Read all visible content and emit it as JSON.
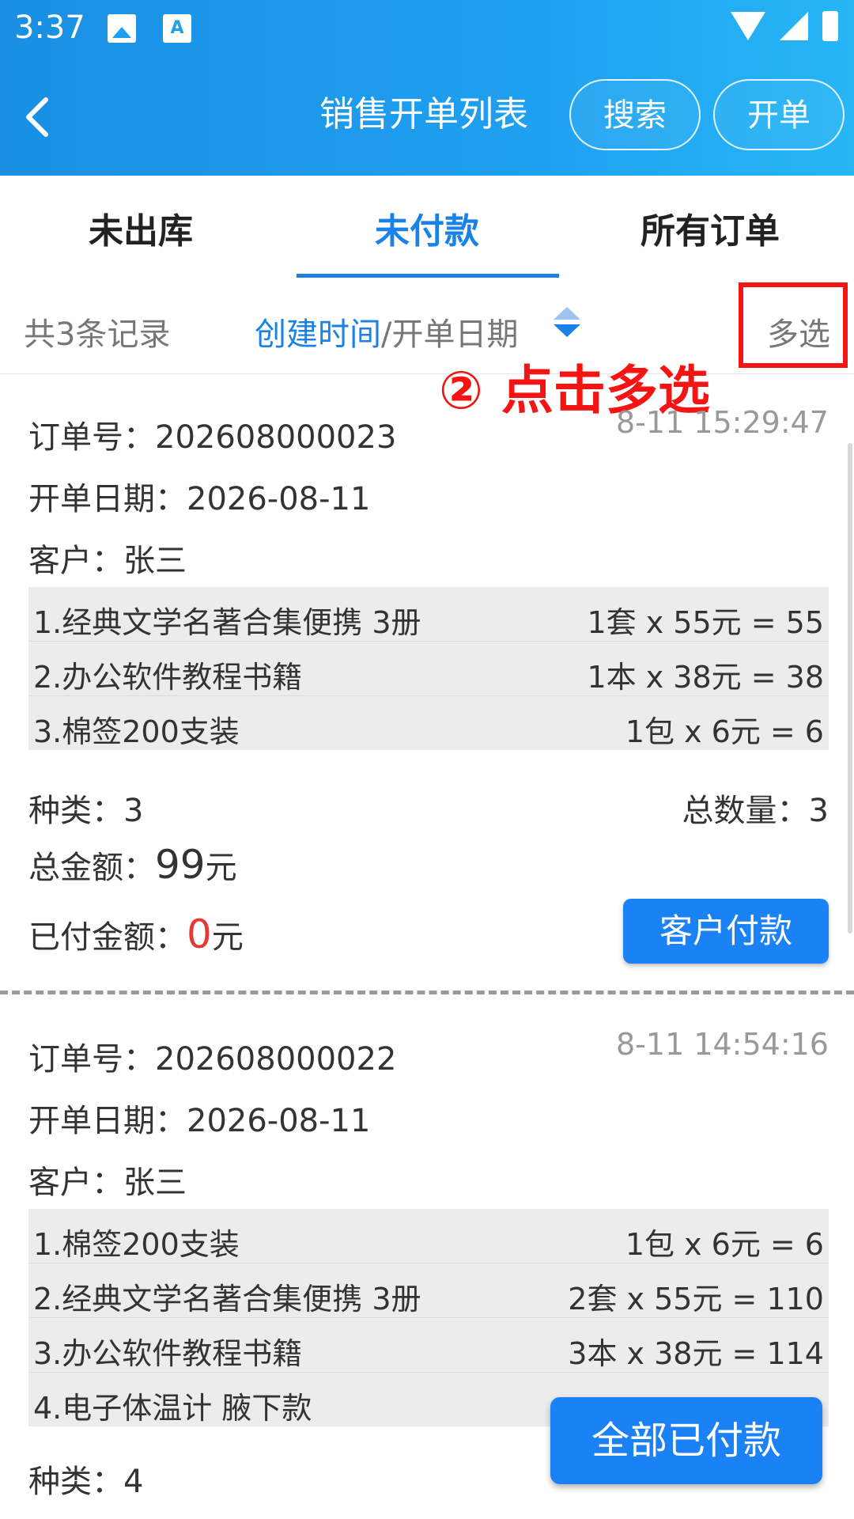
{
  "status": {
    "time": "3:37",
    "a_icon_text": "A"
  },
  "header": {
    "title": "销售开单列表",
    "search_label": "搜索",
    "create_label": "开单"
  },
  "tabs": [
    {
      "label": "未出库",
      "active": false
    },
    {
      "label": "未付款",
      "active": true
    },
    {
      "label": "所有订单",
      "active": false
    }
  ],
  "filter": {
    "count_text": "共3条记录",
    "sort_active": "创建时间",
    "sort_sep_other": "/开单日期",
    "multi_label": "多选"
  },
  "annotation": {
    "text": "② 点击多选",
    "color": "#f41414"
  },
  "orders": [
    {
      "order_no": "订单号：202608000023",
      "time": "8-11 15:29:47",
      "date": "开单日期：2026-08-11",
      "customer": "客户：张三",
      "items": [
        {
          "name": "1.经典文学名著合集便携 3册",
          "calc": "1套 x 55元 = 55"
        },
        {
          "name": "2.办公软件教程书籍",
          "calc": "1本 x 38元 = 38"
        },
        {
          "name": "3.棉签200支装",
          "calc": "1包 x 6元 = 6"
        }
      ],
      "kinds": "种类：3",
      "total_qty": "总数量：3",
      "total_label": "总金额：",
      "total_value": "99",
      "total_unit": "元",
      "paid_label": "已付金额：",
      "paid_value": "0",
      "paid_unit": "元",
      "pay_button": "客户付款"
    },
    {
      "order_no": "订单号：202608000022",
      "time": "8-11 14:54:16",
      "date": "开单日期：2026-08-11",
      "customer": "客户：张三",
      "items": [
        {
          "name": "1.棉签200支装",
          "calc": "1包 x 6元 = 6"
        },
        {
          "name": "2.经典文学名著合集便携 3册",
          "calc": "2套 x 55元 = 110"
        },
        {
          "name": "3.办公软件教程书籍",
          "calc": "3本 x 38元 = 114"
        },
        {
          "name": "4.电子体温计 腋下款",
          "calc": ""
        }
      ],
      "kinds": "种类：4",
      "total_qty": ""
    }
  ],
  "bottom_button": "全部已付款",
  "colors": {
    "primary": "#1a82e6",
    "button": "#1a82f5",
    "paid_zero": "#e53935",
    "header_start": "#1a8fe3",
    "header_end": "#27b6f6"
  }
}
